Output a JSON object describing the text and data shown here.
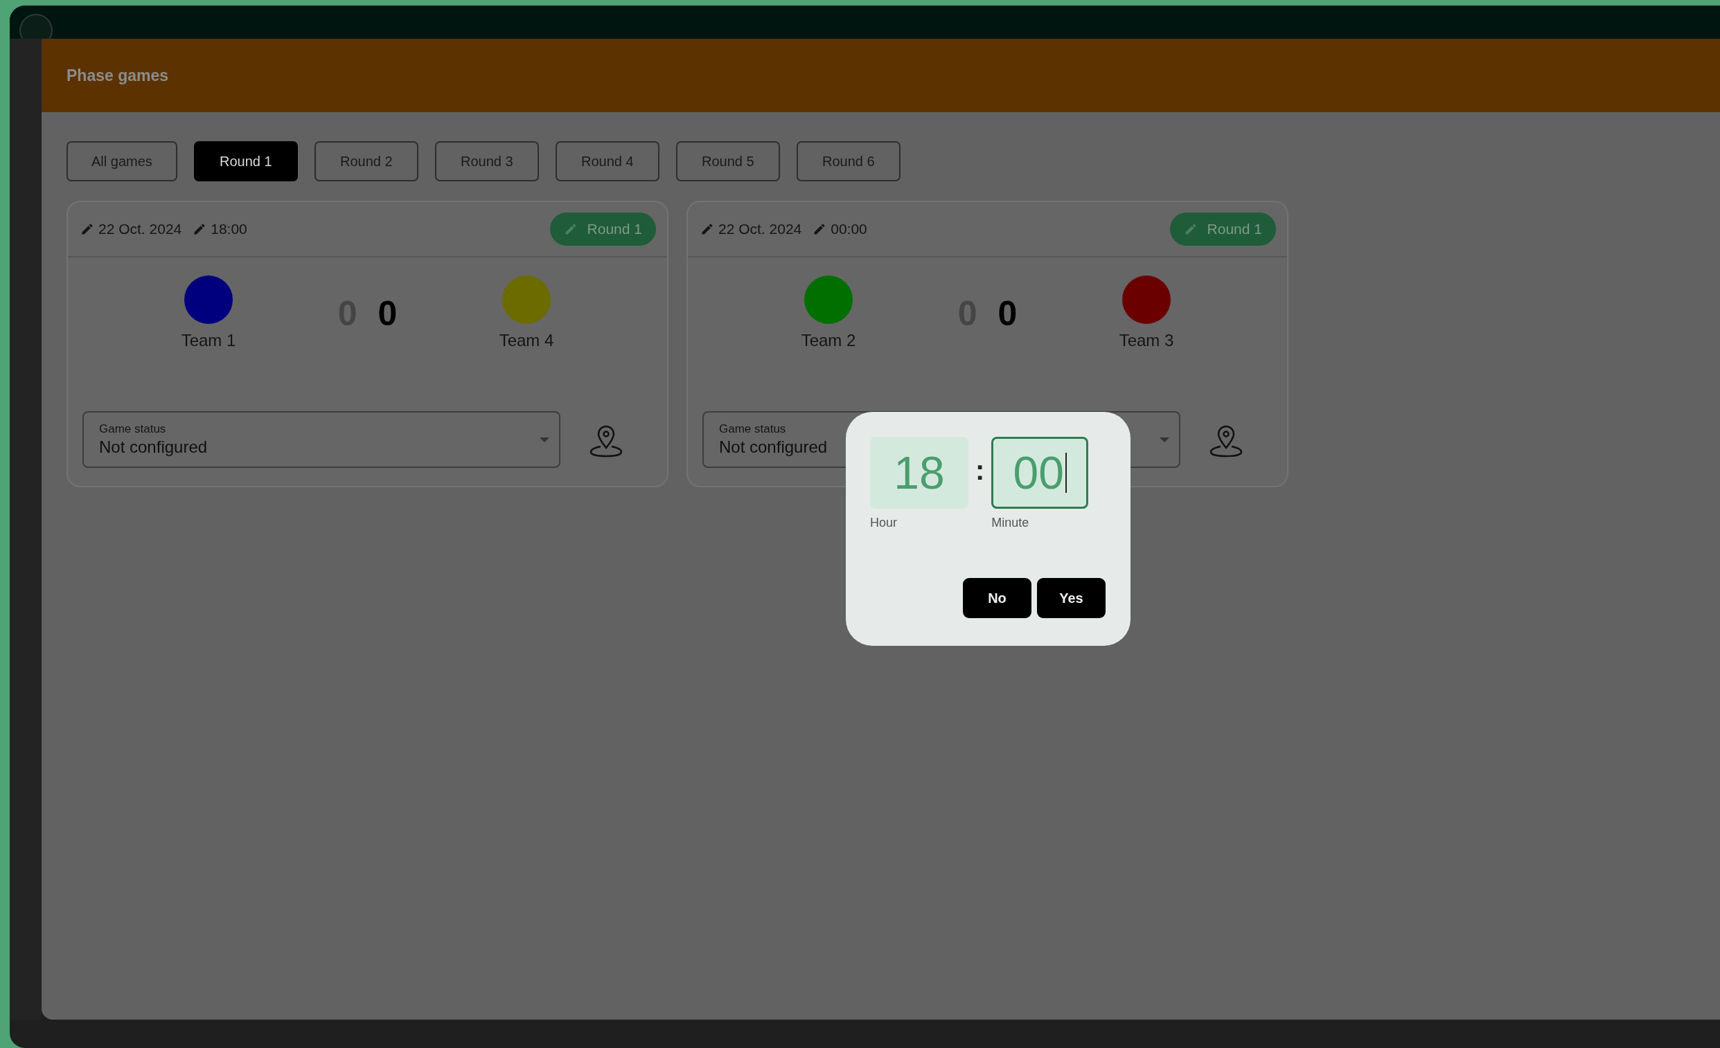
{
  "header": {
    "title": "Phase games"
  },
  "tabs": [
    {
      "label": "All games",
      "selected": false
    },
    {
      "label": "Round 1",
      "selected": true
    },
    {
      "label": "Round 2",
      "selected": false
    },
    {
      "label": "Round 3",
      "selected": false
    },
    {
      "label": "Round 4",
      "selected": false
    },
    {
      "label": "Round 5",
      "selected": false
    },
    {
      "label": "Round 6",
      "selected": false
    }
  ],
  "games": [
    {
      "date": "22 Oct. 2024",
      "time": "18:00",
      "round": "Round 1",
      "home": {
        "name": "Team 1",
        "color": "#00007f"
      },
      "away": {
        "name": "Team 4",
        "color": "#6b6b00"
      },
      "home_score": "0",
      "away_score": "0",
      "status": {
        "label": "Game status",
        "value": "Not configured"
      }
    },
    {
      "date": "22 Oct. 2024",
      "time": "00:00",
      "round": "Round 1",
      "home": {
        "name": "Team 2",
        "color": "#006f00"
      },
      "away": {
        "name": "Team 3",
        "color": "#6b0000"
      },
      "home_score": "0",
      "away_score": "0",
      "status": {
        "label": "Game status",
        "value": "Not configured"
      }
    }
  ],
  "time_dialog": {
    "hour": "18",
    "separator": ":",
    "minute": "00",
    "hour_label": "Hour",
    "minute_label": "Minute",
    "buttons": [
      "No",
      "Yes"
    ]
  }
}
